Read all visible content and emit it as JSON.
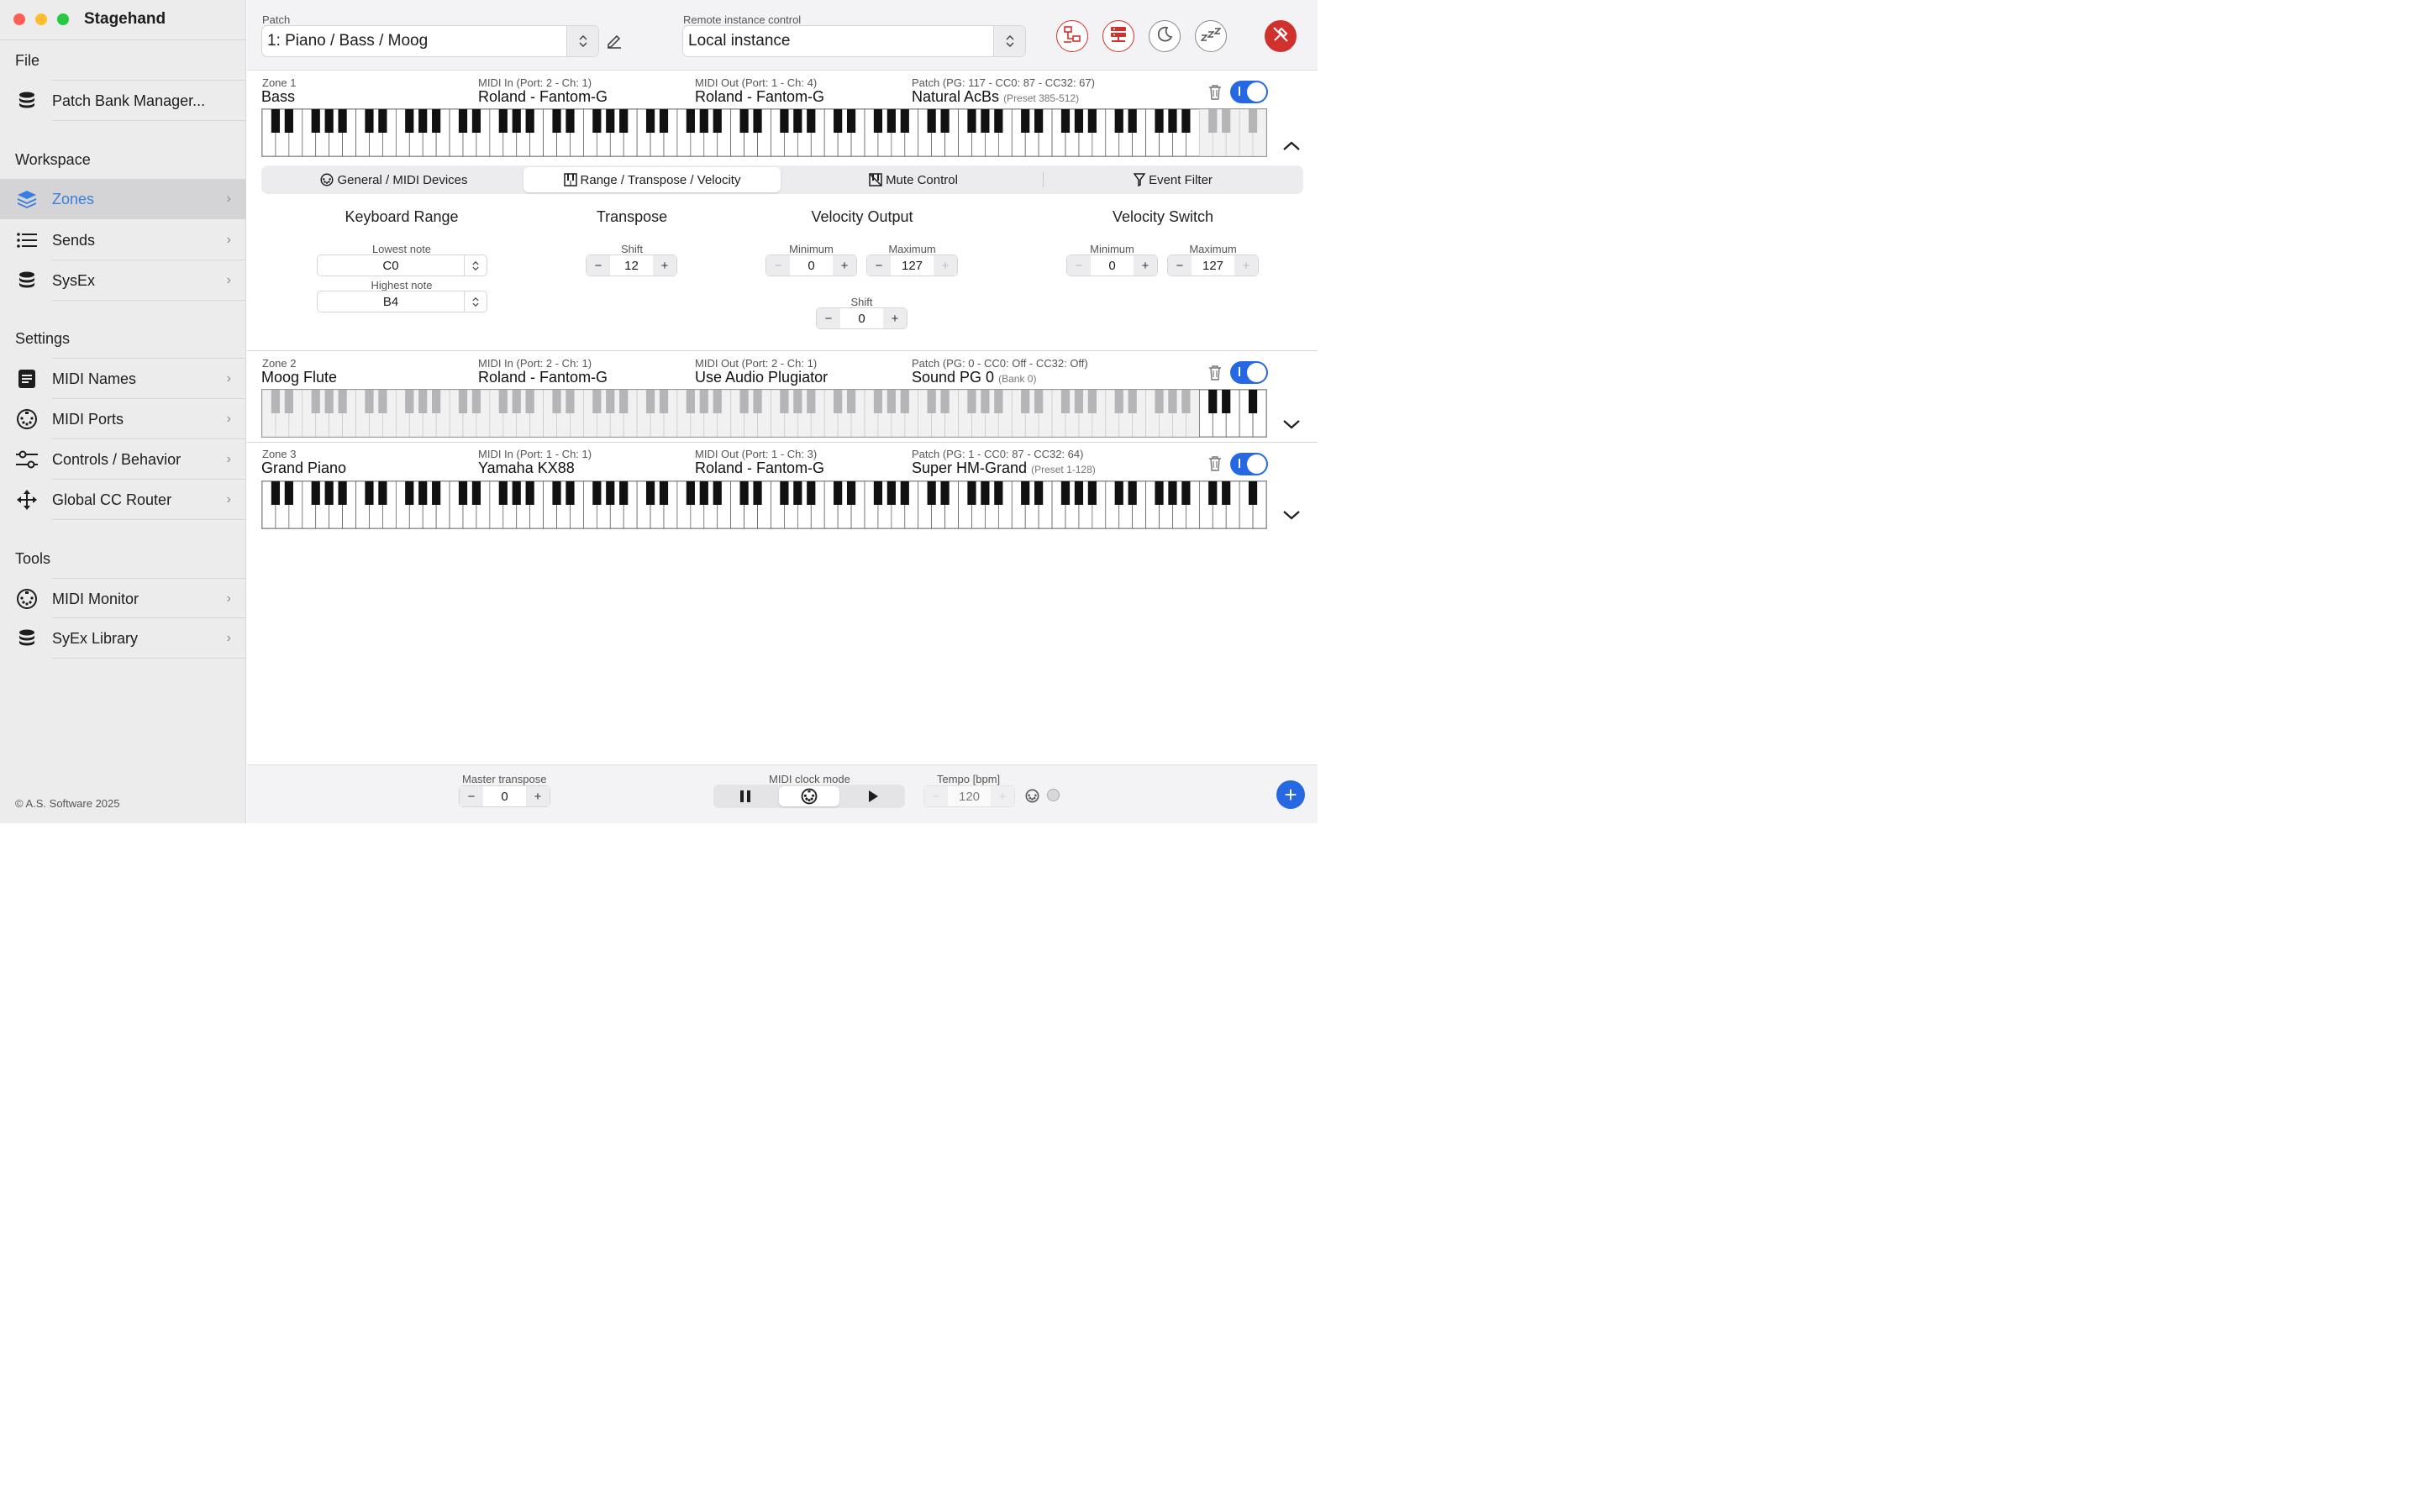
{
  "app": {
    "title": "Stagehand",
    "copyright": "© A.S. Software 2025"
  },
  "sidebar": {
    "sections": {
      "file": "File",
      "workspace": "Workspace",
      "settings": "Settings",
      "tools": "Tools"
    },
    "items": [
      {
        "label": "Patch Bank Manager...",
        "icon": "database-icon"
      },
      {
        "label": "Zones",
        "icon": "layers-icon",
        "active": true
      },
      {
        "label": "Sends",
        "icon": "list-icon"
      },
      {
        "label": "SysEx",
        "icon": "database-icon"
      },
      {
        "label": "MIDI Names",
        "icon": "document-icon"
      },
      {
        "label": "MIDI Ports",
        "icon": "midi-port-icon"
      },
      {
        "label": "Controls / Behavior",
        "icon": "sliders-icon"
      },
      {
        "label": "Global CC Router",
        "icon": "router-icon"
      },
      {
        "label": "MIDI Monitor",
        "icon": "midi-port-icon"
      },
      {
        "label": "SyEx Library",
        "icon": "database-icon"
      }
    ]
  },
  "topbar": {
    "patch_label": "Patch",
    "patch_value": "1: Piano / Bass / Moog",
    "remote_label": "Remote instance control",
    "remote_value": "Local instance",
    "buttons": [
      "network-icon",
      "server-icon",
      "moon-icon",
      "sleep-icon",
      "disconnect-icon"
    ]
  },
  "zones": [
    {
      "zone": "Zone 1",
      "name": "Bass",
      "midi_in_label": "MIDI In (Port: 2 - Ch: 1)",
      "midi_in": "Roland - Fantom-G",
      "midi_out_label": "MIDI Out (Port: 1 - Ch: 4)",
      "midi_out": "Roland - Fantom-G",
      "patch_label": "Patch (PG: 117 - CC0: 87 - CC32: 67)",
      "patch": "Natural AcBs",
      "patch_sub": "(Preset 385-512)",
      "enabled": true,
      "expanded": true
    },
    {
      "zone": "Zone 2",
      "name": "Moog Flute",
      "midi_in_label": "MIDI In (Port: 2 - Ch: 1)",
      "midi_in": "Roland - Fantom-G",
      "midi_out_label": "MIDI Out (Port: 2 - Ch: 1)",
      "midi_out": "Use Audio Plugiator",
      "patch_label": "Patch (PG: 0 - CC0: Off - CC32: Off)",
      "patch": "Sound PG 0",
      "patch_sub": "(Bank 0)",
      "enabled": true,
      "expanded": false
    },
    {
      "zone": "Zone 3",
      "name": "Grand Piano",
      "midi_in_label": "MIDI In (Port: 1 - Ch: 1)",
      "midi_in": "Yamaha KX88",
      "midi_out_label": "MIDI Out (Port: 1 - Ch: 3)",
      "midi_out": "Roland - Fantom-G",
      "patch_label": "Patch (PG: 1 - CC0: 87 - CC32: 64)",
      "patch": "Super HM-Grand",
      "patch_sub": "(Preset 1-128)",
      "enabled": true,
      "expanded": false
    }
  ],
  "tabs": [
    {
      "label": "General / MIDI Devices",
      "icon": "midi-port-icon"
    },
    {
      "label": "Range / Transpose / Velocity",
      "icon": "piano-icon",
      "selected": true
    },
    {
      "label": "Mute Control",
      "icon": "mute-icon"
    },
    {
      "label": "Event Filter",
      "icon": "filter-icon"
    }
  ],
  "editor": {
    "keyboard_range": {
      "title": "Keyboard Range",
      "lowest_label": "Lowest note",
      "lowest": "C0",
      "highest_label": "Highest note",
      "highest": "B4"
    },
    "transpose": {
      "title": "Transpose",
      "shift_label": "Shift",
      "shift": "12"
    },
    "velocity_output": {
      "title": "Velocity Output",
      "min_label": "Minimum",
      "min": "0",
      "max_label": "Maximum",
      "max": "127",
      "shift_label": "Shift",
      "shift": "0"
    },
    "velocity_switch": {
      "title": "Velocity Switch",
      "min_label": "Minimum",
      "min": "0",
      "max_label": "Maximum",
      "max": "127"
    }
  },
  "bottombar": {
    "master_transpose_label": "Master transpose",
    "master_transpose": "0",
    "clock_label": "MIDI clock mode",
    "tempo_label": "Tempo [bpm]",
    "tempo": "120"
  },
  "glyphs": {
    "minus": "−",
    "plus": "+",
    "chevron_right": "›",
    "updown": "⌃⌄"
  }
}
